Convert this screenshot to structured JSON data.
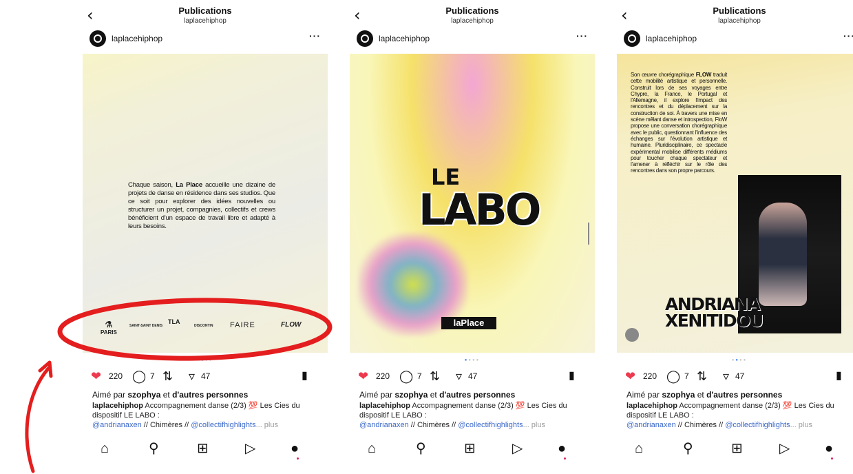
{
  "header": {
    "title": "Publications",
    "subtitle": "laplacehiphop"
  },
  "account": {
    "username": "laplacehiphop",
    "more": "···"
  },
  "slides": {
    "s1": {
      "text_parts": [
        "Chaque saison, ",
        "La Place",
        " accueille une dizaine de projets de danse en résidence dans ses studios. Que ce soit pour explorer des idées nouvelles ou structurer un projet, compagnies, collectifs et crews bénéficient d'un espace de travail libre et adapté à leurs besoins."
      ],
      "logos": [
        "PARIS",
        "SAINT-SAINT DENIS",
        "TLA",
        "DISCONTIN",
        "FAIRE",
        "FLOW"
      ]
    },
    "s2": {
      "le": "LE",
      "labo": "LABO",
      "logo": "laPlace"
    },
    "s3": {
      "text_parts": [
        "Son œuvre chorégraphique ",
        "FLOW",
        " traduit cette mobilité artistique et personnelle. Construit lors de ses voyages entre Chypre, la France, le Portugal et l'Allemagne, il explore l'impact des rencontres et du déplacement sur la construction de soi. À travers une mise en scène mêlant danse et introspection, FloW propose une conversation chorégraphique avec le public, questionnant l'influence des échanges sur l'évolution artistique et humaine. Pluridisciplinaire, ce spectacle expérimental mobilise différents médiums pour toucher chaque spectateur et l'amener à réfléchir sur le rôle des rencontres dans son propre parcours."
      ],
      "name_line1": "ANDRIANA",
      "name_line2": "XENITIDOU"
    }
  },
  "post": {
    "likes_count": "220",
    "comments_count": "7",
    "shares_count": "47",
    "liked_by_prefix": "Aimé par ",
    "liked_by_user": "szophya",
    "liked_by_middle": " et ",
    "liked_by_others": "d'autres personnes",
    "caption_user": "laplacehiphop",
    "caption_text": " Accompagnement danse (2/3) 💯 Les Cies du dispositif LE LABO :",
    "caption_mention1": "@andrianaxen",
    "caption_sep": " // Chimères // ",
    "caption_mention2": "@collectifhighlights",
    "caption_more": "... plus"
  },
  "icons": {
    "back": "chevron-left-icon",
    "heart": "heart-icon",
    "comment": "comment-icon",
    "repost": "repost-icon",
    "share": "send-icon",
    "bookmark": "bookmark-icon",
    "home": "home-icon",
    "search": "search-icon",
    "create": "plus-square-icon",
    "reels": "reels-icon",
    "profile": "profile-icon"
  },
  "colors": {
    "heart": "#ed3a4f",
    "annotation": "#e41e1e",
    "link": "#3b68c9"
  },
  "carousel": {
    "slides": 4,
    "active": [
      1,
      0,
      1
    ]
  }
}
